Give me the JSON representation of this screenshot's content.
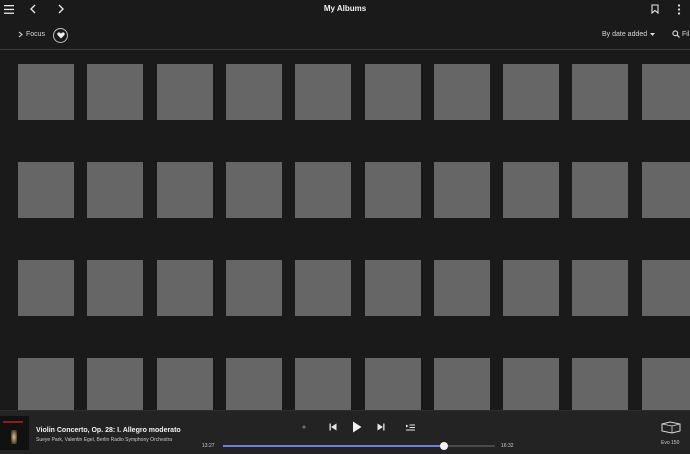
{
  "header": {
    "title": "My Albums",
    "menu_icon": "hamburger-menu-icon",
    "back_icon": "chevron-left-icon",
    "forward_icon": "chevron-right-icon",
    "bookmark_icon": "bookmark-icon",
    "more_icon": "more-vertical-icon"
  },
  "filterbar": {
    "focus_label": "Focus",
    "favorites_icon": "heart-icon",
    "sort_label": "By date added",
    "filter_label": "Fil"
  },
  "grid": {
    "rows": 4,
    "columns": 10,
    "placeholder_color": "#666666"
  },
  "now_playing": {
    "title": "Violin Concerto, Op. 28: I. Allegro moderato",
    "artists": "Sueye Park, Valentin Egel, Berlin Radio Symphony Orchestra",
    "elapsed": "13:27",
    "duration": "16:32",
    "progress_fraction": 0.813,
    "device_name": "Evo 150",
    "accent_color": "#6d82d6"
  }
}
